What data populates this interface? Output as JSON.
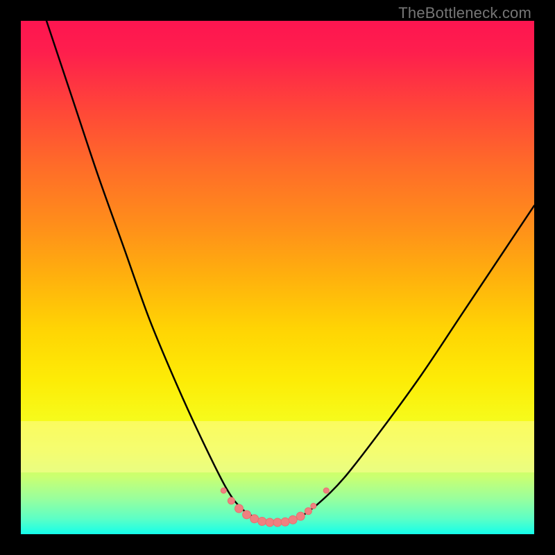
{
  "watermark": "TheBottleneck.com",
  "colors": {
    "frame": "#000000",
    "curve": "#000000",
    "marker_fill": "#ef8080",
    "marker_stroke": "#e86f6f"
  },
  "chart_data": {
    "type": "line",
    "title": "",
    "xlabel": "",
    "ylabel": "",
    "xlim": [
      0,
      100
    ],
    "ylim": [
      0,
      100
    ],
    "grid": false,
    "legend": false,
    "description": "Two black curves descending from top-left and top-right meeting near a flat minimum around x≈45–55 at y≈2–4; coral markers cluster at the trough and along both curve branches near the bottom.",
    "series": [
      {
        "name": "left-branch",
        "x": [
          5,
          10,
          15,
          20,
          25,
          30,
          35,
          40,
          43,
          46
        ],
        "y": [
          100,
          85,
          70,
          56,
          42,
          30,
          19,
          9,
          5,
          3
        ]
      },
      {
        "name": "right-branch",
        "x": [
          54,
          58,
          63,
          70,
          78,
          86,
          94,
          100
        ],
        "y": [
          3,
          6,
          11,
          20,
          31,
          43,
          55,
          64
        ]
      }
    ],
    "markers": [
      {
        "x": 39.5,
        "y": 8.5,
        "r": 4
      },
      {
        "x": 41.0,
        "y": 6.5,
        "r": 5
      },
      {
        "x": 42.5,
        "y": 5.0,
        "r": 6
      },
      {
        "x": 44.0,
        "y": 3.8,
        "r": 6
      },
      {
        "x": 45.5,
        "y": 3.0,
        "r": 6
      },
      {
        "x": 47.0,
        "y": 2.5,
        "r": 6
      },
      {
        "x": 48.5,
        "y": 2.3,
        "r": 6
      },
      {
        "x": 50.0,
        "y": 2.3,
        "r": 6
      },
      {
        "x": 51.5,
        "y": 2.4,
        "r": 6
      },
      {
        "x": 53.0,
        "y": 2.8,
        "r": 6
      },
      {
        "x": 54.5,
        "y": 3.5,
        "r": 6
      },
      {
        "x": 56.0,
        "y": 4.5,
        "r": 5
      },
      {
        "x": 57.0,
        "y": 5.5,
        "r": 4
      },
      {
        "x": 59.5,
        "y": 8.5,
        "r": 4
      }
    ]
  }
}
